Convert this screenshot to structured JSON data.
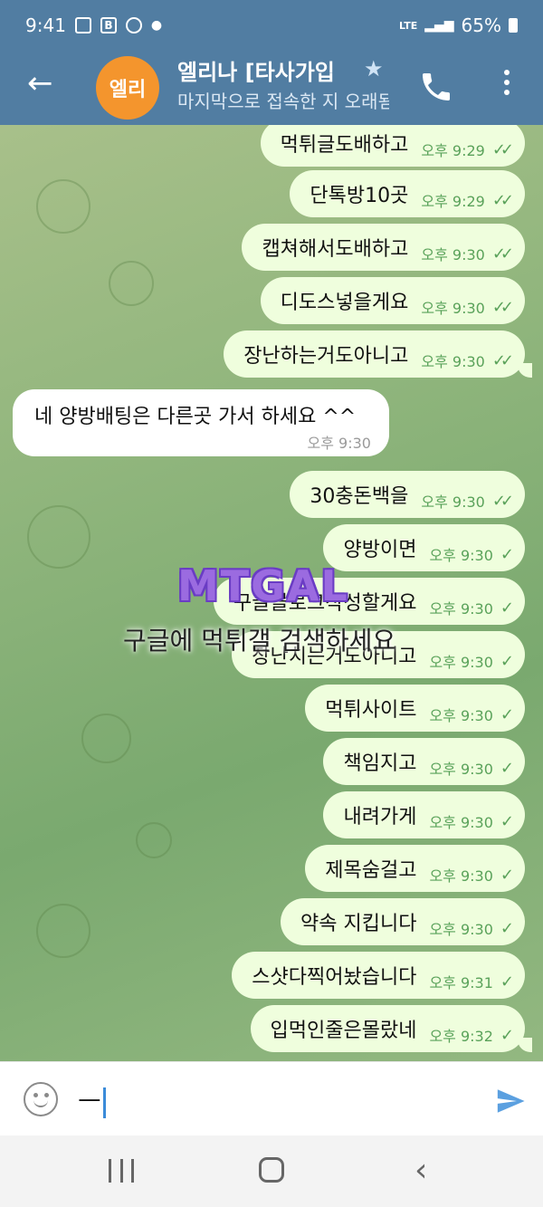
{
  "status_bar": {
    "time": "9:41",
    "battery": "65%",
    "network": "LTE"
  },
  "header": {
    "back_glyph": "←",
    "avatar_text": "엘리",
    "title": "엘리나 [타사가입",
    "subtitle": "마지막으로 접속한 지 오래됨"
  },
  "messages": [
    {
      "text": "먹튀글도배하고",
      "time": "오후 9:29",
      "read": true
    },
    {
      "text": "단톡방10곳",
      "time": "오후 9:29",
      "read": true
    },
    {
      "text": "캡쳐해서도배하고",
      "time": "오후 9:30",
      "read": true
    },
    {
      "text": "디도스넣을게요",
      "time": "오후 9:30",
      "read": true
    },
    {
      "text": "장난하는거도아니고",
      "time": "오후 9:30",
      "read": true
    }
  ],
  "incoming": {
    "text": "네 양방배팅은 다른곳 가서 하세요 ^^",
    "time": "오후 9:30"
  },
  "messages2": [
    {
      "text": "30충돈백을",
      "time": "오후 9:30",
      "read": true
    },
    {
      "text": "양방이면",
      "time": "오후 9:30",
      "read": false
    },
    {
      "text": "구글블로그작성할게요",
      "time": "오후 9:30",
      "read": false
    },
    {
      "text": "장난치는거도아니고",
      "time": "오후 9:30",
      "read": false
    },
    {
      "text": "먹튀사이트",
      "time": "오후 9:30",
      "read": false
    },
    {
      "text": "책임지고",
      "time": "오후 9:30",
      "read": false
    },
    {
      "text": "내려가게",
      "time": "오후 9:30",
      "read": false
    },
    {
      "text": "제목숨걸고",
      "time": "오후 9:30",
      "read": false
    },
    {
      "text": "약속 지킵니다",
      "time": "오후 9:30",
      "read": false
    },
    {
      "text": "스샷다찍어놨습니다",
      "time": "오후 9:31",
      "read": false
    },
    {
      "text": "입먹인줄은몰랐네",
      "time": "오후 9:32",
      "read": false
    }
  ],
  "watermark": {
    "logo": "MTGAL",
    "text": "구글에 먹튀갤 검색하세요"
  },
  "input": {
    "value": "ㅡ"
  },
  "icons": {
    "call": "phone-icon",
    "more": "more-vert-icon",
    "emoji": "emoji-icon",
    "send": "send-icon"
  },
  "colors": {
    "header": "#517da2",
    "outgoing_bubble": "#effedd",
    "check": "#5aa25a",
    "avatar": "#f4952d"
  }
}
